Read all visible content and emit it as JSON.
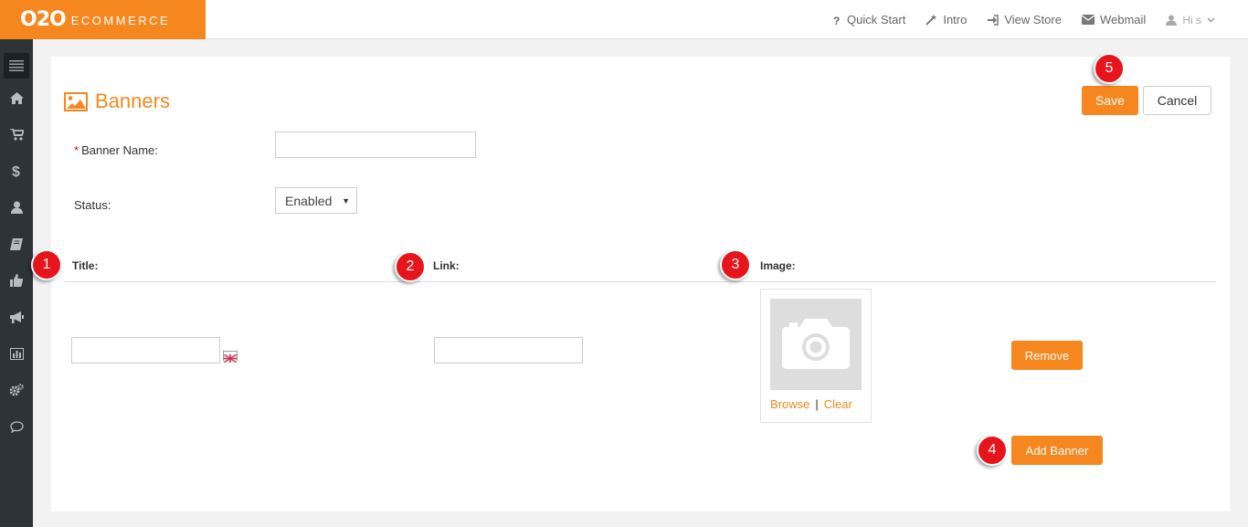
{
  "header": {
    "logo_mark": "O2O",
    "logo_text": "ECOMMERCE",
    "nav": {
      "quick_start": "Quick Start",
      "intro": "Intro",
      "view_store": "View Store",
      "webmail": "Webmail",
      "user": "Hi s"
    }
  },
  "sidebar": {
    "items": [
      "menu-icon",
      "home-icon",
      "cart-icon",
      "dollar-icon",
      "user-icon",
      "book-icon",
      "thumbs-up-icon",
      "megaphone-icon",
      "chart-icon",
      "gears-icon",
      "chat-icon"
    ]
  },
  "page": {
    "title": "Banners",
    "save_label": "Save",
    "cancel_label": "Cancel"
  },
  "form": {
    "banner_name_required": "*",
    "banner_name_label": "Banner Name:",
    "banner_name_value": "",
    "status_label": "Status:",
    "status_value": "Enabled"
  },
  "columns": {
    "title": "Title:",
    "link": "Link:",
    "image": "Image:"
  },
  "banner_row": {
    "title_value": "",
    "link_value": "",
    "browse_label": "Browse",
    "separator": "|",
    "clear_label": "Clear",
    "remove_label": "Remove"
  },
  "add_banner_label": "Add Banner",
  "markers": [
    "1",
    "2",
    "3",
    "4",
    "5"
  ],
  "colors": {
    "accent": "#f6871f",
    "sidebar": "#2e3338",
    "marker": "#e8141c"
  }
}
